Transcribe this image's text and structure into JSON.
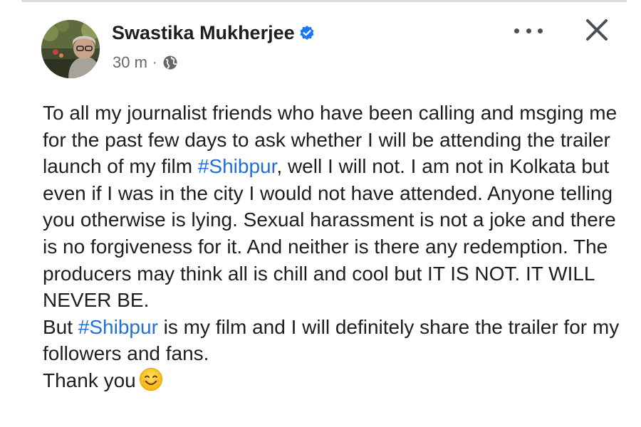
{
  "post": {
    "author_name": "Swastika Mukherjee",
    "verified": true,
    "timestamp": "30 m",
    "separator": "·",
    "privacy_icon": "globe-icon",
    "more_icon": "more-options-icon",
    "close_icon": "close-icon",
    "body": {
      "p1_a": "To all my journalist friends who have been calling and msging me for the past few days to ask whether I will be attending the trailer launch of my film ",
      "hashtag1": "#Shibpur",
      "p1_b": ", well I will not. I am not in Kolkata but even if I was in the city I would not have attended. Anyone telling you otherwise is lying. Sexual harassment is not a joke and there is no forgiveness for it. And neither is there any redemption. The producers may think all is chill and cool but IT IS NOT. IT WILL NEVER BE.",
      "p2_a": "But ",
      "hashtag2": "#Shibpur",
      "p2_b": " is my film and I will definitely share the trailer for my followers and fans.",
      "p3": "Thank you",
      "emoji": "smiling-face-emoji"
    }
  },
  "colors": {
    "hashtag": "#216fdb",
    "verified_badge": "#1877f2",
    "meta_text": "#65676b"
  }
}
